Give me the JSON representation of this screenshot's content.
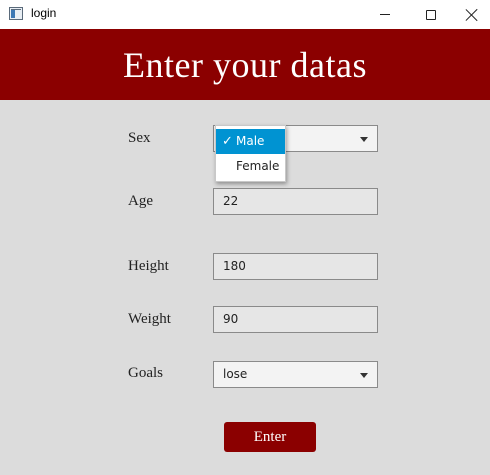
{
  "window": {
    "title": "login",
    "icon": "app-window-icon"
  },
  "header": {
    "title": "Enter your datas"
  },
  "form": {
    "sex": {
      "label": "Sex",
      "options": [
        "Male",
        "Female"
      ],
      "selected": "Male",
      "dropdown_open": true
    },
    "age": {
      "label": "Age",
      "value": "22"
    },
    "height": {
      "label": "Height",
      "value": "180"
    },
    "weight": {
      "label": "Weight",
      "value": "90"
    },
    "goals": {
      "label": "Goals",
      "value": "lose"
    },
    "submit_label": "Enter"
  },
  "colors": {
    "header_bg": "#8b0000",
    "button_bg": "#8b0000",
    "form_bg": "#dcdcdc",
    "selection": "#0093d2"
  }
}
